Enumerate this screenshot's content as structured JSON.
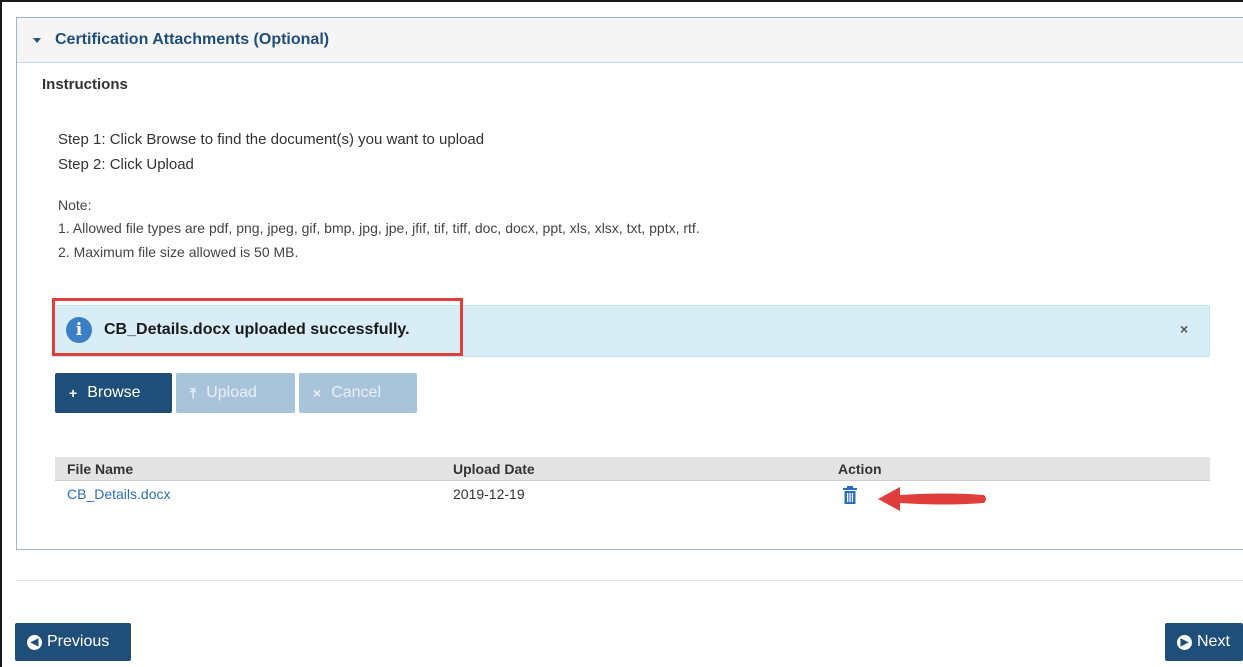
{
  "panel": {
    "title": "Certification Attachments (Optional)"
  },
  "instructions": {
    "title": "Instructions",
    "steps": [
      "Step 1: Click Browse to find the document(s) you want to upload",
      "Step 2: Click Upload"
    ],
    "note_label": "Note:",
    "notes": [
      "1. Allowed file types are pdf, png, jpeg, gif, bmp, jpg, jpe, jfif, tif, tiff, doc, docx, ppt, xls, xlsx, txt, pptx, rtf.",
      "2. Maximum file size allowed is 50 MB."
    ]
  },
  "alert": {
    "icon_glyph": "i",
    "message": "CB_Details.docx uploaded successfully.",
    "close_glyph": "×",
    "highlight_color": "#e03d3d"
  },
  "buttons": {
    "browse": {
      "icon": "+",
      "label": "Browse"
    },
    "upload": {
      "icon": "⤒",
      "label": "Upload"
    },
    "cancel": {
      "icon": "×",
      "label": "Cancel"
    }
  },
  "table": {
    "headers": [
      "File Name",
      "Upload Date",
      "Action"
    ],
    "rows": [
      {
        "file_name": "CB_Details.docx",
        "upload_date": "2019-12-19",
        "action_icon": "trash-icon"
      }
    ]
  },
  "nav": {
    "previous": {
      "icon": "◀",
      "label": "Previous"
    },
    "next": {
      "icon": "▶",
      "label": "Next"
    }
  },
  "colors": {
    "primary": "#1f4e78",
    "alert_bg": "#d9edf7",
    "link": "#2a6ebb",
    "disabled_button": "#a9c4da"
  }
}
